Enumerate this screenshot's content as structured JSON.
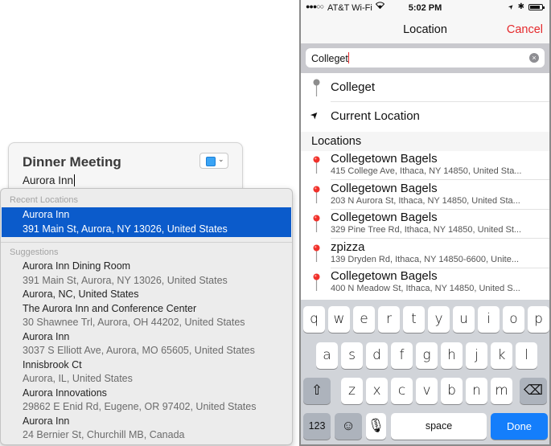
{
  "mac": {
    "event_title": "Dinner Meeting",
    "location_value": "Aurora Inn",
    "calendar_color": "#3aa4f5",
    "dropdown": {
      "recent_header": "Recent Locations",
      "recent": [
        {
          "name": "Aurora Inn",
          "address": "391 Main St, Aurora, NY  13026, United States",
          "selected": true
        }
      ],
      "suggestions_header": "Suggestions",
      "suggestions": [
        {
          "name": "Aurora Inn Dining Room",
          "address": "391 Main St, Aurora, NY  13026, United States"
        },
        {
          "name": "Aurora, NC, United States",
          "address": ""
        },
        {
          "name": "The Aurora Inn and Conference Center",
          "address": "30 Shawnee Trl, Aurora, OH  44202, United States"
        },
        {
          "name": "Aurora Inn",
          "address": "3037 S Elliott Ave, Aurora, MO  65605, United States"
        },
        {
          "name": "Innisbrook Ct",
          "address": "Aurora, IL, United States"
        },
        {
          "name": "Aurora Innovations",
          "address": "29862 E Enid Rd, Eugene, OR  97402, United States"
        },
        {
          "name": "Aurora Inn",
          "address": "24 Bernier St, Churchill MB, Canada"
        }
      ]
    }
  },
  "ios": {
    "status": {
      "signal": "●●●○○",
      "carrier": "AT&T Wi-Fi",
      "wifi_icon": "wifi-icon",
      "time": "5:02 PM",
      "location_icon": "➤",
      "bluetooth_icon": "✱"
    },
    "nav": {
      "title": "Location",
      "cancel": "Cancel"
    },
    "search": {
      "value": "Colleget",
      "clear_icon": "×"
    },
    "typed_row": "Colleget",
    "current_location": "Current Location",
    "current_location_icon": "➤",
    "locations_header": "Locations",
    "locations": [
      {
        "name": "Collegetown Bagels",
        "address": "415 College Ave, Ithaca, NY  14850, United Sta..."
      },
      {
        "name": "Collegetown Bagels",
        "address": "203 N Aurora St, Ithaca, NY  14850, United Sta..."
      },
      {
        "name": "Collegetown Bagels",
        "address": "329 Pine Tree Rd, Ithaca, NY  14850, United St..."
      },
      {
        "name": "zpizza",
        "address": "139 Dryden Rd, Ithaca, NY  14850-6600, Unite..."
      },
      {
        "name": "Collegetown Bagels",
        "address": "400 N Meadow St, Ithaca, NY  14850, United S..."
      }
    ],
    "keyboard": {
      "row1": [
        "q",
        "w",
        "e",
        "r",
        "t",
        "y",
        "u",
        "i",
        "o",
        "p"
      ],
      "row2": [
        "a",
        "s",
        "d",
        "f",
        "g",
        "h",
        "j",
        "k",
        "l"
      ],
      "row3": [
        "z",
        "x",
        "c",
        "v",
        "b",
        "n",
        "m"
      ],
      "shift": "⇧",
      "delete": "⌫",
      "numbers": "123",
      "emoji": "☺",
      "mic": "🎙",
      "space": "space",
      "done": "Done"
    },
    "accent_color": "#e5292c",
    "done_color": "#147efb"
  }
}
